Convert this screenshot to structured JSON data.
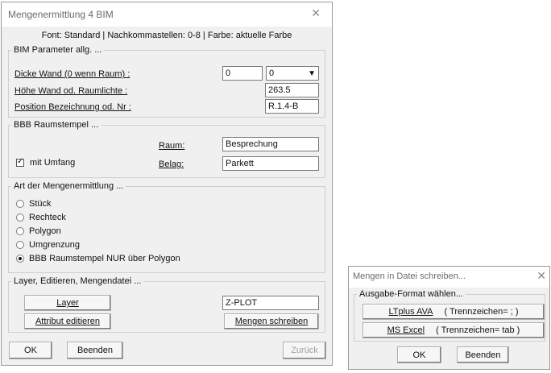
{
  "main_dialog": {
    "title": "Mengenermittlung 4 BIM",
    "close_glyph": "✕",
    "info_line": "Font: Standard  |  Nachkommastellen: 0-8  |  Farbe: aktuelle Farbe",
    "bim_group": {
      "legend": "BIM Parameter allg. ...",
      "wall_label": "Dicke Wand (0 wenn Raum) :",
      "wall_value": "0",
      "wall_combo_value": "0",
      "height_label": "Höhe Wand od. Raumlichte :",
      "height_value": "263.5",
      "position_label": "Position Bezeichnung od. Nr :",
      "position_value": "R.1.4-B"
    },
    "room_group": {
      "legend": "BBB Raumstempel ...",
      "room_label": "Raum:",
      "room_value": "Besprechung",
      "perimeter_label": "mit Umfang",
      "perimeter_checked": true,
      "floor_label": "Belag:",
      "floor_value": "Parkett"
    },
    "method_group": {
      "legend": "Art der Mengenermittlung ...",
      "options": [
        "Stück",
        "Rechteck",
        "Polygon",
        "Umgrenzung",
        "BBB Raumstempel NUR über Polygon"
      ],
      "selected_index": 4
    },
    "layer_group": {
      "legend": "Layer, Editieren, Mengendatei ...",
      "layer_button": "Layer",
      "layer_value": "Z-PLOT",
      "edit_attr_button": "Attribut editieren",
      "write_button": "Mengen schreiben"
    },
    "ok_button": "OK",
    "exit_button": "Beenden",
    "back_button": "Zurück"
  },
  "export_dialog": {
    "title": "Mengen in Datei schreiben...",
    "close_glyph": "✕",
    "legend": "Ausgabe-Format wählen...",
    "ava_name": "LTplus AVA",
    "ava_sep": "( Trennzeichen= ; )",
    "excel_name": "MS Excel",
    "excel_sep": "( Trennzeichen= tab )",
    "ok_button": "OK",
    "exit_button": "Beenden"
  },
  "colors": {
    "dialog_bg": "#f0f0f0",
    "title_text": "#6b6b6b",
    "disabled_text": "#a0a0a0"
  }
}
